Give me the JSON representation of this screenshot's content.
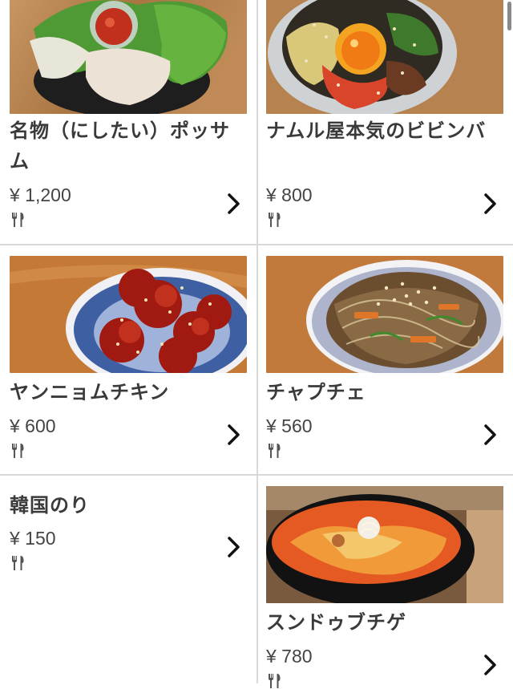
{
  "items": [
    {
      "name_line1": "名物（にしたい）ポッサ",
      "name_line2": "ム",
      "price": "¥ 1,200",
      "icon": "utensils-icon",
      "action_icon": "chevron-right-icon"
    },
    {
      "name_line1": "ナムル屋本気のビビンバ",
      "name_line2": "",
      "price": "¥ 800",
      "icon": "utensils-icon",
      "action_icon": "chevron-right-icon"
    },
    {
      "name_line1": "ヤンニョムチキン",
      "name_line2": "",
      "price": "¥ 600",
      "icon": "utensils-icon",
      "action_icon": "chevron-right-icon"
    },
    {
      "name_line1": "チャプチェ",
      "name_line2": "",
      "price": "¥ 560",
      "icon": "utensils-icon",
      "action_icon": "chevron-right-icon"
    },
    {
      "name_line1": "韓国のり",
      "name_line2": "",
      "price": "¥ 150",
      "icon": "utensils-icon",
      "action_icon": "chevron-right-icon"
    },
    {
      "name_line1": "スンドゥブチゲ",
      "name_line2": "",
      "price": "¥ 780",
      "icon": "utensils-icon",
      "action_icon": "chevron-right-icon"
    }
  ],
  "colors": {
    "divider": "#d9d9d9",
    "text": "#3a3a3a",
    "wood": "#b9824a"
  }
}
